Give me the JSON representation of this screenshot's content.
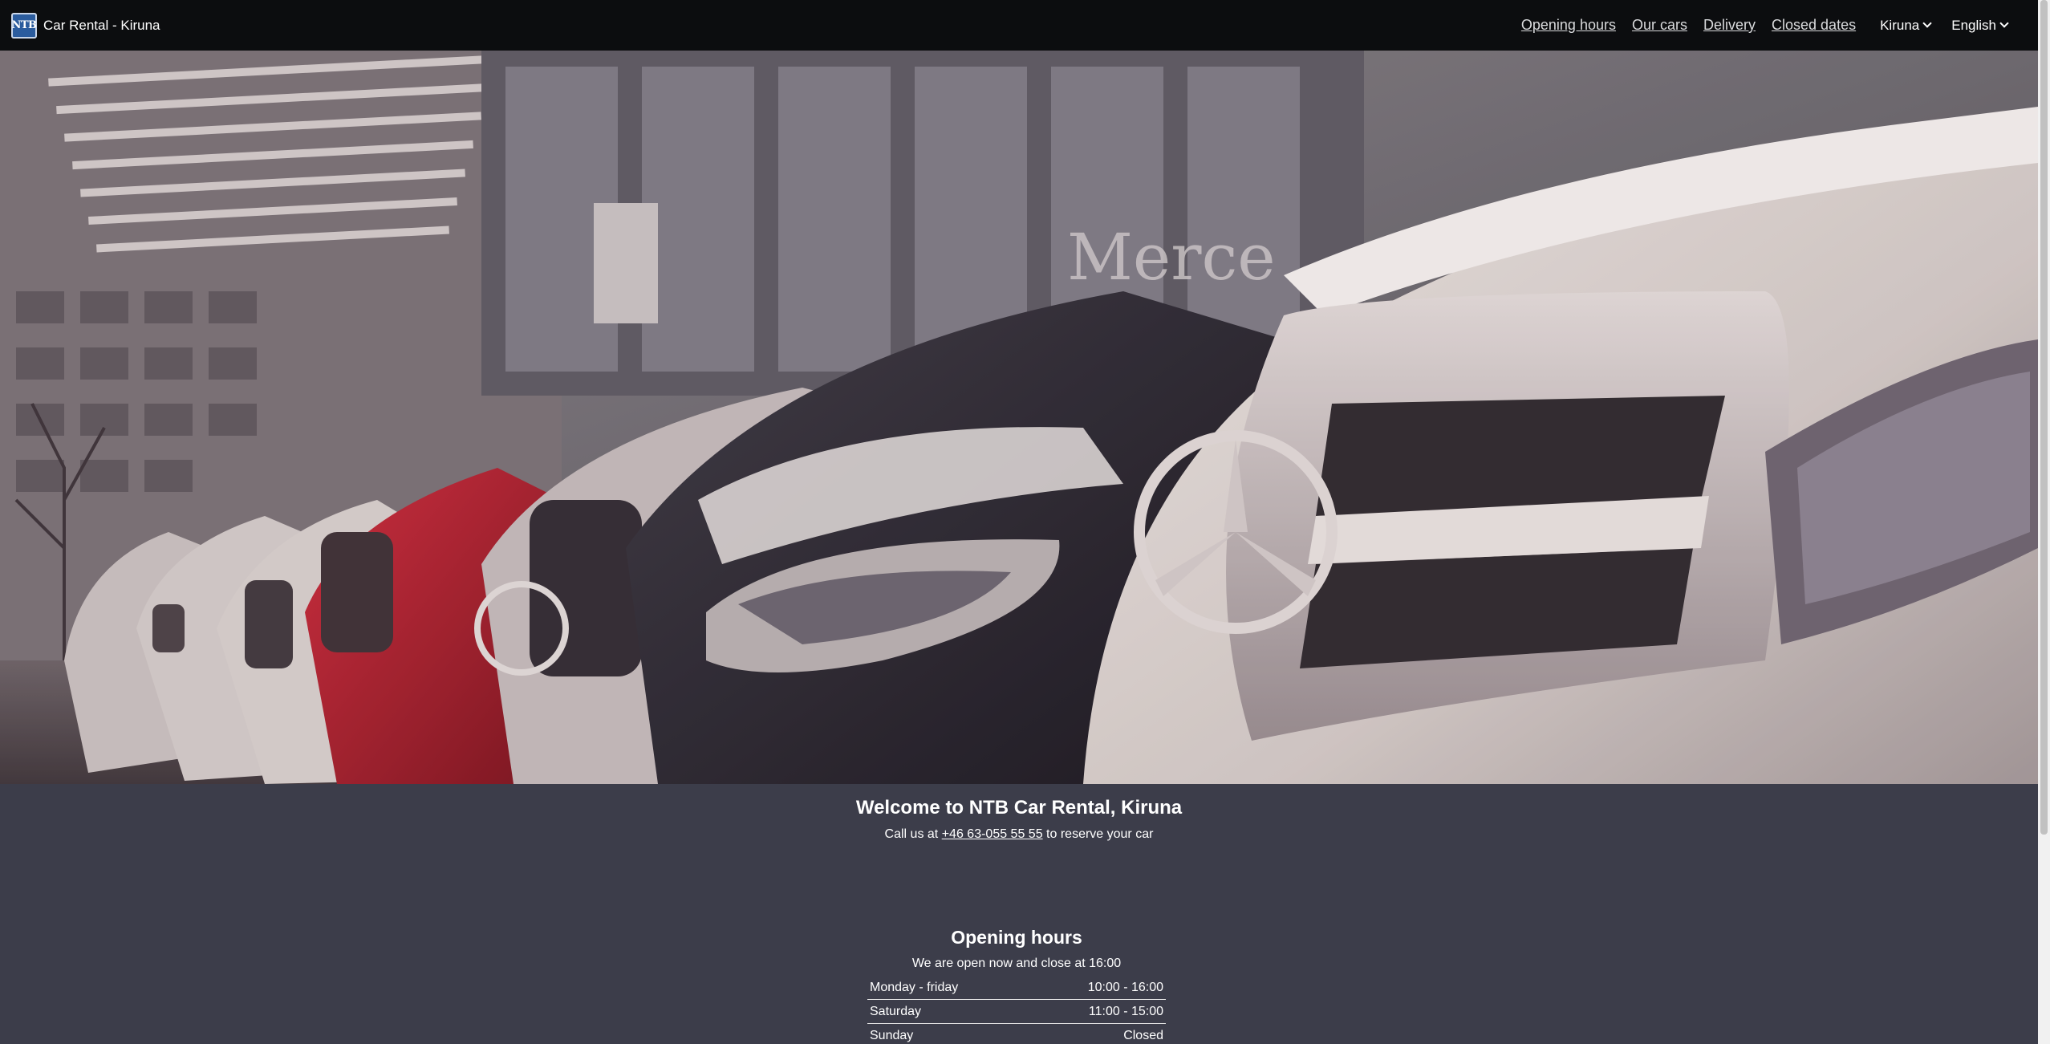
{
  "navbar": {
    "brand_logo_text": "NTB",
    "brand_title": "Car Rental - Kiruna",
    "links": [
      {
        "label": "Opening hours"
      },
      {
        "label": "Our cars"
      },
      {
        "label": "Delivery"
      },
      {
        "label": "Closed dates"
      }
    ],
    "location_select": "Kiruna",
    "language_select": "English"
  },
  "hero": {
    "image": "row-of-mercedes-cars-photo",
    "sign_text": "Merce"
  },
  "welcome": {
    "title": "Welcome to NTB Car Rental, Kiruna",
    "call_prefix": "Call us at",
    "phone": "+46 63-055 55 55",
    "call_suffix": "to reserve your car"
  },
  "opening_hours": {
    "title": "Opening hours",
    "status": "We are open now and close at 16:00",
    "rows": [
      {
        "day": "Monday - friday",
        "time": "10:00 - 16:00"
      },
      {
        "day": "Saturday",
        "time": "11:00 - 15:00"
      },
      {
        "day": "Sunday",
        "time": "Closed"
      }
    ]
  },
  "colors": {
    "navbar_bg": "#0c0d0f",
    "page_bg": "#3c3d4a",
    "logo_bg": "#2b5c9e",
    "text": "#ffffff"
  }
}
